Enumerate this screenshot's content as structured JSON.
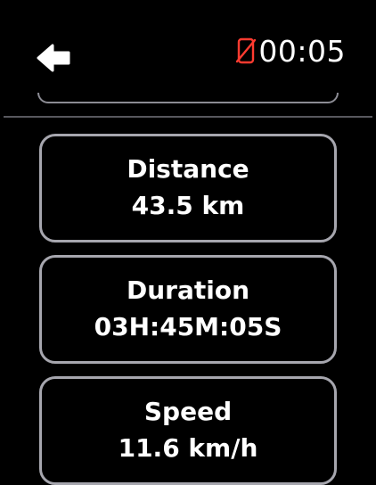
{
  "header": {
    "back_icon": "arrow-left-icon",
    "phone_status_icon": "phone-disconnected-icon",
    "phone_status_color": "#ff3b30",
    "time": "00:05"
  },
  "metrics": [
    {
      "label": "Distance",
      "value": "43.5 km"
    },
    {
      "label": "Duration",
      "value": "03H:45M:05S"
    },
    {
      "label": "Speed",
      "value": "11.6 km/h"
    }
  ]
}
